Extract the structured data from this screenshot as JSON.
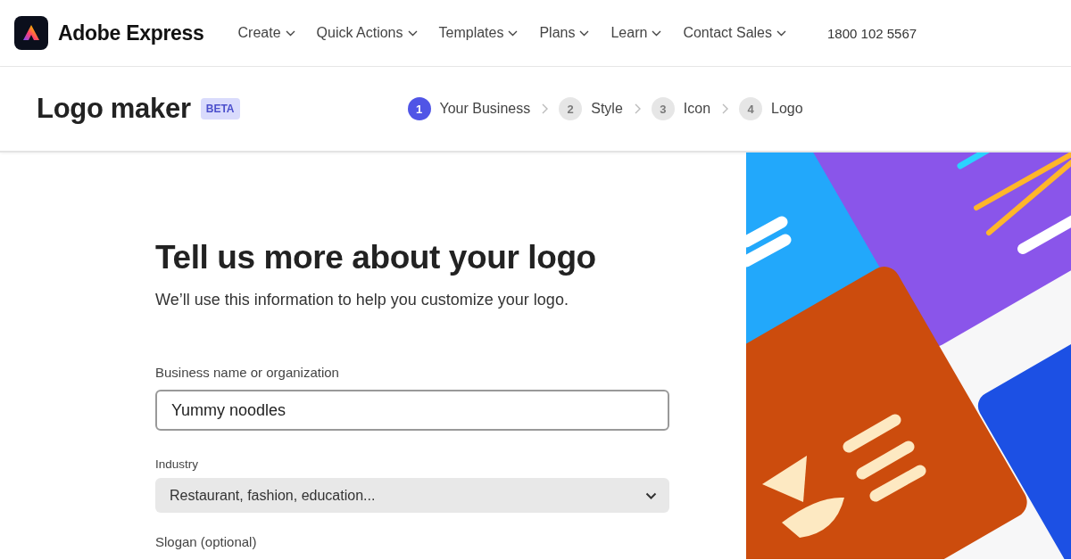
{
  "header": {
    "brand": "Adobe Express",
    "nav": [
      {
        "label": "Create"
      },
      {
        "label": "Quick Actions"
      },
      {
        "label": "Templates"
      },
      {
        "label": "Plans"
      },
      {
        "label": "Learn"
      },
      {
        "label": "Contact Sales"
      }
    ],
    "phone": "1800 102 5567"
  },
  "subheader": {
    "title": "Logo maker",
    "badge": "BETA",
    "steps": [
      {
        "number": "1",
        "label": "Your Business",
        "selected": true
      },
      {
        "number": "2",
        "label": "Style",
        "selected": false
      },
      {
        "number": "3",
        "label": "Icon",
        "selected": false
      },
      {
        "number": "4",
        "label": "Logo",
        "selected": false
      }
    ]
  },
  "form": {
    "heading": "Tell us more about your logo",
    "subtitle": "We’ll use this information to help you customize your logo.",
    "fields": [
      {
        "kind": "text",
        "label": "Business name or organization",
        "value": "Yummy noodles"
      },
      {
        "kind": "select",
        "label": "Industry",
        "placeholder": "Restaurant, fashion, education..."
      },
      {
        "kind": "label",
        "label": "Slogan (optional)"
      }
    ]
  }
}
